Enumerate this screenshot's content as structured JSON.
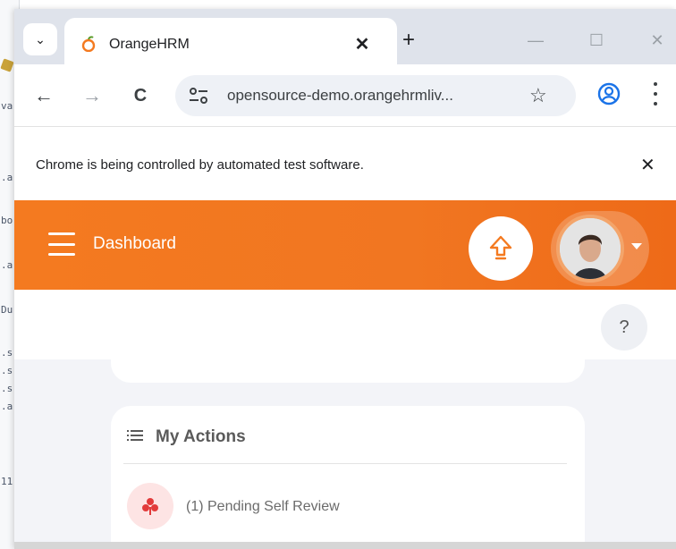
{
  "background_editor": {
    "fragments": [
      "va",
      ".a",
      "bo",
      ".a",
      "Du",
      ".s",
      ".s",
      ".s",
      ".a",
      "11"
    ]
  },
  "browser": {
    "tab": {
      "title": "OrangeHRM",
      "close_glyph": "✕",
      "tab_search_glyph": "⌄",
      "new_tab_glyph": "+"
    },
    "window_controls": {
      "minimize": "—",
      "maximize": "☐",
      "close": "✕"
    },
    "toolbar": {
      "back_glyph": "←",
      "forward_glyph": "→",
      "reload_glyph": "C",
      "url": "opensource-demo.orangehrmliv...",
      "bookmark_glyph": "☆"
    },
    "infobar": {
      "message": "Chrome is being controlled by automated test software.",
      "close_glyph": "✕"
    }
  },
  "app": {
    "header": {
      "title": "Dashboard",
      "accent_color": "#f47a20"
    },
    "help_glyph": "?",
    "my_actions": {
      "title": "My Actions",
      "items": [
        {
          "label": "(1) Pending Self Review",
          "icon": "person-review-icon",
          "badge_color": "#fde4e4",
          "icon_color": "#e23b3b"
        }
      ]
    }
  },
  "icons": {
    "favicon": "orangehrm-favicon",
    "omnibox_left": "tune-icon",
    "profile": "profile-icon",
    "upgrade": "upgrade-icon",
    "menu": "hamburger-icon"
  }
}
